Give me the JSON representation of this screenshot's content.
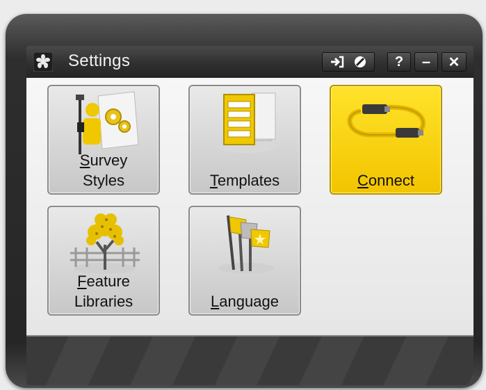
{
  "window": {
    "title": "Settings",
    "controls": {
      "help_label": "?",
      "minimize_label": "–",
      "close_label": "✕"
    }
  },
  "tiles": [
    {
      "id": "survey-styles",
      "label": "Survey\nStyles",
      "icon": "survey-styles-icon",
      "selected": false
    },
    {
      "id": "templates",
      "label": "Templates",
      "icon": "templates-icon",
      "selected": false
    },
    {
      "id": "connect",
      "label": "Connect",
      "icon": "cable-icon",
      "selected": true
    },
    {
      "id": "feature-libraries",
      "label": "Feature\nLibraries",
      "icon": "tree-icon",
      "selected": false
    },
    {
      "id": "language",
      "label": "Language",
      "icon": "flags-icon",
      "selected": false
    }
  ],
  "colors": {
    "accent_yellow": "#f7d200",
    "titlebar": "#303030",
    "content_bg": "#f0f0f0"
  }
}
